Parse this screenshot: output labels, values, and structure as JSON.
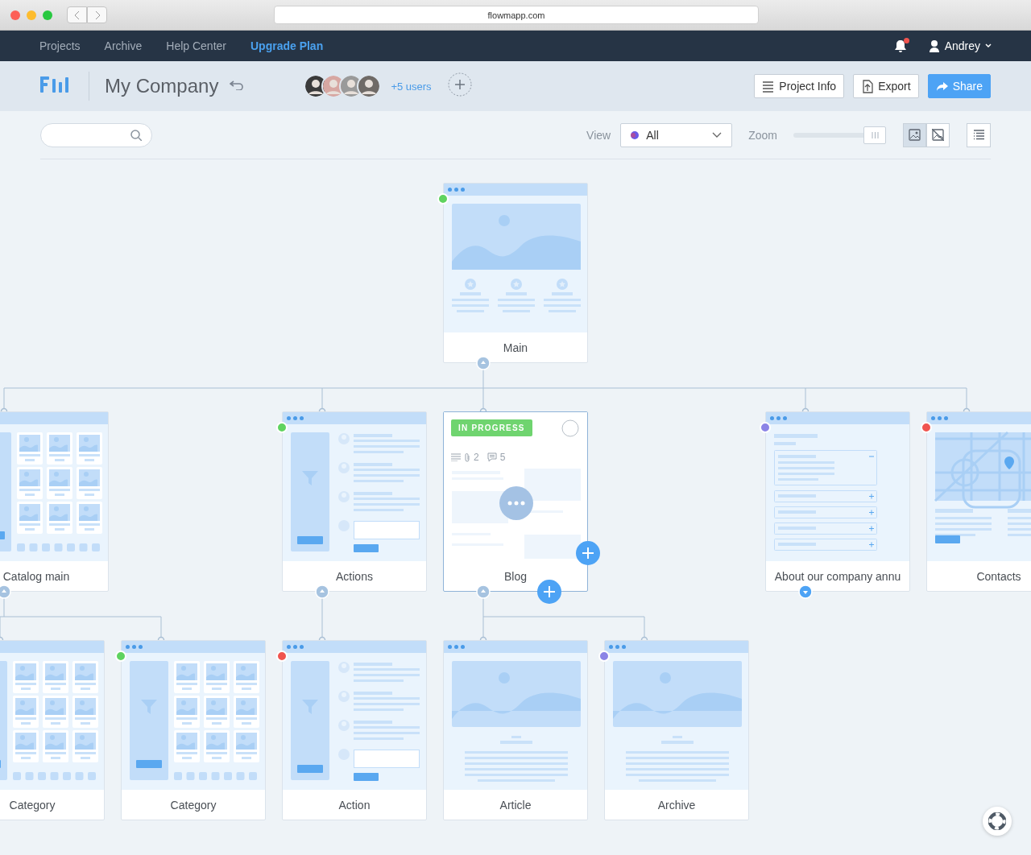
{
  "browser": {
    "url": "flowmapp.com"
  },
  "nav": {
    "items": [
      {
        "label": "Projects",
        "highlighted": false
      },
      {
        "label": "Archive",
        "highlighted": false
      },
      {
        "label": "Help Center",
        "highlighted": false
      },
      {
        "label": "Upgrade Plan",
        "highlighted": true
      }
    ],
    "notifications": {
      "unread": true
    },
    "user": {
      "name": "Andrey"
    }
  },
  "project": {
    "title": "My Company",
    "members": {
      "extra": "+5 users"
    },
    "buttons": [
      {
        "label": "Project Info",
        "kind": "info"
      },
      {
        "label": "Export",
        "kind": "export"
      },
      {
        "label": "Share",
        "kind": "share"
      }
    ]
  },
  "toolbar": {
    "view": {
      "label": "View",
      "value": "All"
    },
    "zoom": {
      "label": "Zoom",
      "level": 1
    },
    "display_modes": [
      {
        "selected": true
      },
      {
        "selected": false
      }
    ]
  },
  "sitemap": {
    "pages": [
      {
        "title": "Main",
        "kind": "hero",
        "color": "#5fd35f",
        "expanded": true,
        "selected": false,
        "children": [
          {
            "title": "Catalog main",
            "kind": "catalog",
            "expanded": true,
            "selected": false,
            "children": [
              {
                "title": "Category",
                "kind": "catalog",
                "selected": false
              },
              {
                "title": "Category",
                "kind": "catalog",
                "color": "#5fd35f",
                "selected": false
              }
            ]
          },
          {
            "title": "Actions",
            "kind": "list",
            "color": "#5fd35f",
            "expanded": true,
            "selected": false,
            "children": [
              {
                "title": "Action",
                "kind": "list",
                "color": "#f0544f",
                "selected": false
              }
            ]
          },
          {
            "title": "Blog",
            "kind": "details",
            "badge": "IN PROGRESS",
            "attachments": "2",
            "comments": "5",
            "expanded": true,
            "selected": true,
            "children": [
              {
                "title": "Article",
                "kind": "article",
                "selected": false
              },
              {
                "title": "Archive",
                "kind": "article",
                "color": "#8b84e6",
                "selected": false
              }
            ]
          },
          {
            "title": "About our company annu",
            "kind": "faq",
            "color": "#8b84e6",
            "expanded": false,
            "selected": false
          },
          {
            "title": "Contacts",
            "kind": "map",
            "color": "#f0544f",
            "selected": false
          }
        ]
      }
    ]
  }
}
